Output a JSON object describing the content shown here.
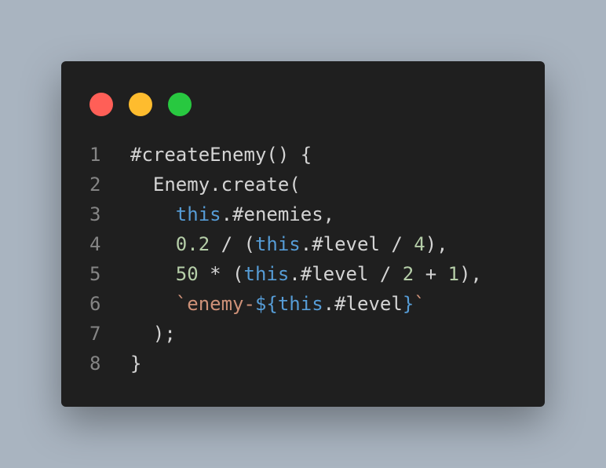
{
  "colors": {
    "background": "#a9b4c0",
    "window": "#1f1f1f",
    "dot_red": "#ff5f57",
    "dot_yellow": "#febc2e",
    "dot_green": "#28c840",
    "line_number": "#858585",
    "text": "#d4d4d4",
    "keyword": "#569cd6",
    "number": "#b5cea8",
    "string": "#ce9178"
  },
  "window_controls": [
    {
      "name": "close-dot",
      "color": "#ff5f57"
    },
    {
      "name": "minimize-dot",
      "color": "#febc2e"
    },
    {
      "name": "maximize-dot",
      "color": "#28c840"
    }
  ],
  "code": {
    "lines": [
      {
        "number": "1",
        "tokens": [
          {
            "t": "plain",
            "v": "#createEnemy() {"
          }
        ]
      },
      {
        "number": "2",
        "tokens": [
          {
            "t": "plain",
            "v": "  Enemy.create("
          }
        ]
      },
      {
        "number": "3",
        "tokens": [
          {
            "t": "plain",
            "v": "    "
          },
          {
            "t": "kw",
            "v": "this"
          },
          {
            "t": "plain",
            "v": ".#enemies,"
          }
        ]
      },
      {
        "number": "4",
        "tokens": [
          {
            "t": "plain",
            "v": "    "
          },
          {
            "t": "num",
            "v": "0.2"
          },
          {
            "t": "plain",
            "v": " / ("
          },
          {
            "t": "kw",
            "v": "this"
          },
          {
            "t": "plain",
            "v": ".#level / "
          },
          {
            "t": "num",
            "v": "4"
          },
          {
            "t": "plain",
            "v": "),"
          }
        ]
      },
      {
        "number": "5",
        "tokens": [
          {
            "t": "plain",
            "v": "    "
          },
          {
            "t": "num",
            "v": "50"
          },
          {
            "t": "plain",
            "v": " * ("
          },
          {
            "t": "kw",
            "v": "this"
          },
          {
            "t": "plain",
            "v": ".#level / "
          },
          {
            "t": "num",
            "v": "2"
          },
          {
            "t": "plain",
            "v": " + "
          },
          {
            "t": "num",
            "v": "1"
          },
          {
            "t": "plain",
            "v": "),"
          }
        ]
      },
      {
        "number": "6",
        "tokens": [
          {
            "t": "plain",
            "v": "    "
          },
          {
            "t": "str",
            "v": "`enemy-"
          },
          {
            "t": "kw",
            "v": "${this"
          },
          {
            "t": "plain",
            "v": ".#level"
          },
          {
            "t": "kw",
            "v": "}"
          },
          {
            "t": "str",
            "v": "`"
          }
        ]
      },
      {
        "number": "7",
        "tokens": [
          {
            "t": "plain",
            "v": "  );"
          }
        ]
      },
      {
        "number": "8",
        "tokens": [
          {
            "t": "plain",
            "v": "}"
          }
        ]
      }
    ]
  }
}
